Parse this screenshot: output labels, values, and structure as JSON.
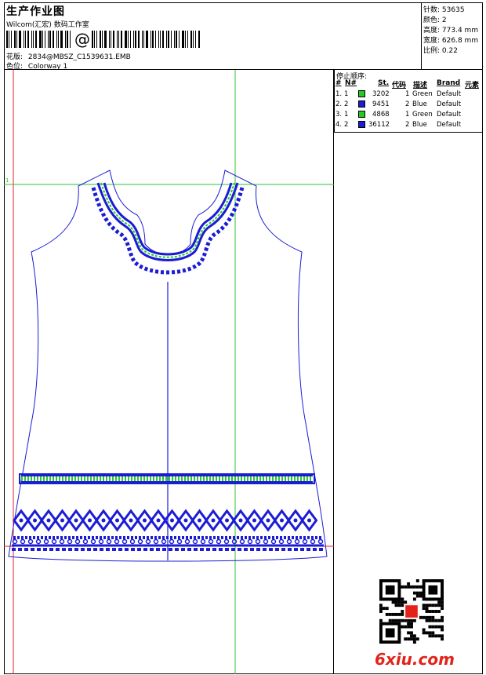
{
  "header": {
    "title": "生产作业图",
    "company": "Wilcom(汇宏) 数码工作室",
    "barcode_symbol": "@",
    "pattern_label": "花版:",
    "pattern_value": "2834@MBSZ_C1539631.EMB",
    "colorway_label": "色位:",
    "colorway_value": "Colorway 1"
  },
  "stats": [
    {
      "label": "针数:",
      "value": "53635"
    },
    {
      "label": "颜色:",
      "value": "2"
    },
    {
      "label": "高度:",
      "value": "773.4 mm"
    },
    {
      "label": "宽度:",
      "value": "626.8 mm"
    },
    {
      "label": "比例:",
      "value": "0.22"
    }
  ],
  "sequence": {
    "title": "停止顺序:",
    "headers": {
      "seq": "#",
      "needle": "N#",
      "st": "St.",
      "code": "代码",
      "desc": "描述",
      "brand": "Brand",
      "element": "元素"
    },
    "rows": [
      {
        "seq": "1.",
        "needle": "1",
        "color": "#22cc22",
        "st": "3202",
        "code": "1",
        "desc": "Green",
        "brand": "Default"
      },
      {
        "seq": "2.",
        "needle": "2",
        "color": "#1c1cd6",
        "st": "9451",
        "code": "2",
        "desc": "Blue",
        "brand": "Default"
      },
      {
        "seq": "3.",
        "needle": "1",
        "color": "#22cc22",
        "st": "4868",
        "code": "1",
        "desc": "Green",
        "brand": "Default"
      },
      {
        "seq": "4.",
        "needle": "2",
        "color": "#1c1cd6",
        "st": "36112",
        "code": "2",
        "desc": "Blue",
        "brand": "Default"
      }
    ]
  },
  "watermark": {
    "text": "6xiu.com"
  },
  "colors": {
    "blue": "#1c1cd6",
    "green": "#22cc22",
    "guide_green": "#2fc22f",
    "guide_red": "#e02020",
    "logo_red": "#e2231a"
  },
  "icons": {
    "qr": "qr-code-icon"
  }
}
